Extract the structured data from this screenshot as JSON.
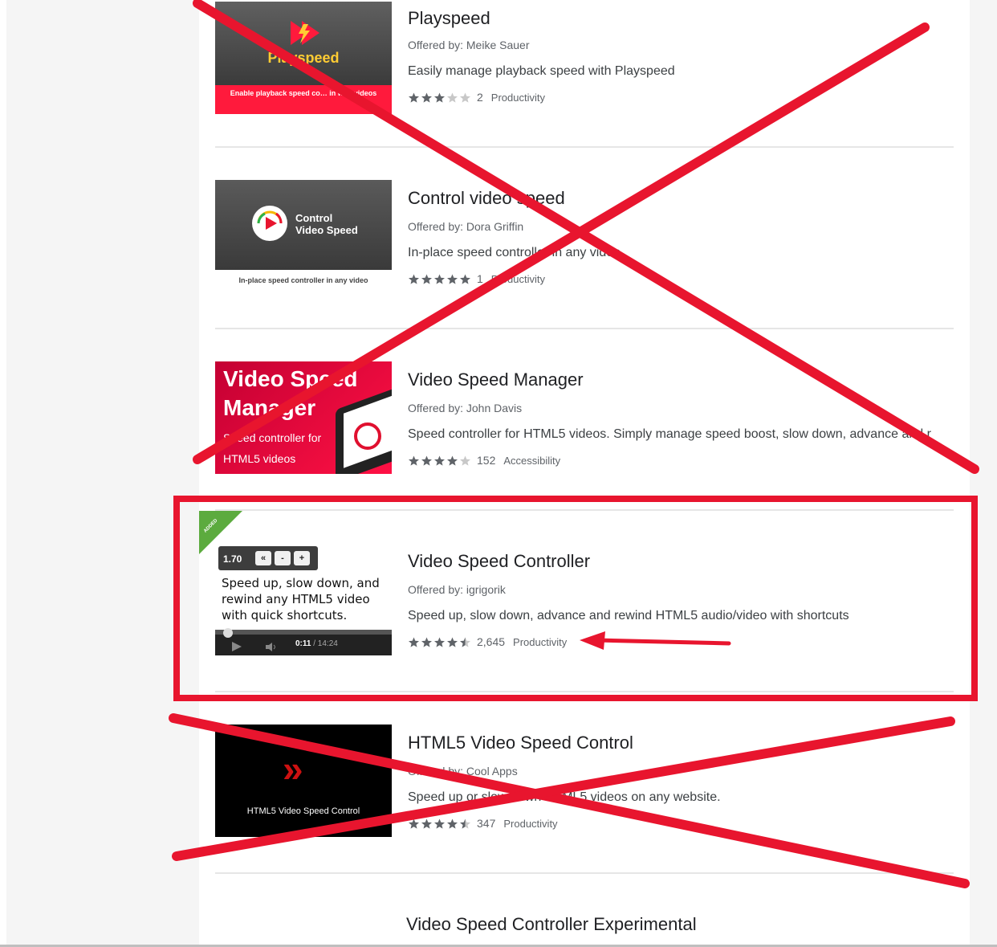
{
  "items": [
    {
      "title": "Playspeed",
      "offered_by": "Offered by: Meike Sauer",
      "description": "Easily manage playback speed with Playspeed",
      "rating_stars": 3,
      "rating_count": "2",
      "category": "Productivity",
      "thumb": {
        "brand": "Playspeed",
        "band_text": "Enable playback speed co… in web videos"
      }
    },
    {
      "title": "Control video speed",
      "offered_by": "Offered by: Dora Griffin",
      "description": "In-place speed controller in any video",
      "rating_stars": 5,
      "rating_count": "1",
      "category": "Productivity",
      "thumb": {
        "line1": "Control",
        "line2": "Video Speed",
        "sub": "In-place speed controller in any video"
      }
    },
    {
      "title": "Video Speed Manager",
      "offered_by": "Offered by: John Davis",
      "description": "Speed controller for HTML5 videos. Simply manage speed boost, slow down, advance and r",
      "rating_stars": 4,
      "rating_count": "152",
      "category": "Accessibility",
      "thumb": {
        "big1": "Video Speed",
        "big2": "Manager",
        "small1": "Speed controller for",
        "small2": "HTML5 videos"
      }
    },
    {
      "title": "Video Speed Controller",
      "offered_by": "Offered by: igrigorik",
      "description": "Speed up, slow down, advance and rewind HTML5 audio/video with shortcuts",
      "rating_stars": 4.5,
      "rating_count": "2,645",
      "category": "Productivity",
      "thumb": {
        "speed": "1.70",
        "btn1": "«",
        "btn2": "-",
        "btn3": "+",
        "caption": "Speed up, slow down, and rewind any HTML5 video with quick shortcuts.",
        "time_current": "0:11",
        "time_total": " / 14:24",
        "ribbon": "ADDED"
      }
    },
    {
      "title": "HTML5 Video Speed Control",
      "offered_by": "Offered by: Cool Apps",
      "description": "Speed up or slow down HTML5 videos on any website.",
      "rating_stars": 4.5,
      "rating_count": "347",
      "category": "Productivity",
      "thumb": {
        "chevrons": "»",
        "label": "HTML5 Video Speed Control"
      }
    },
    {
      "title": "Video Speed Controller Experimental"
    }
  ],
  "colors": {
    "annotation_red": "#e8152e",
    "star_filled": "#5f6368",
    "star_empty": "#c8c8c8",
    "added_green": "#5cab3e"
  }
}
